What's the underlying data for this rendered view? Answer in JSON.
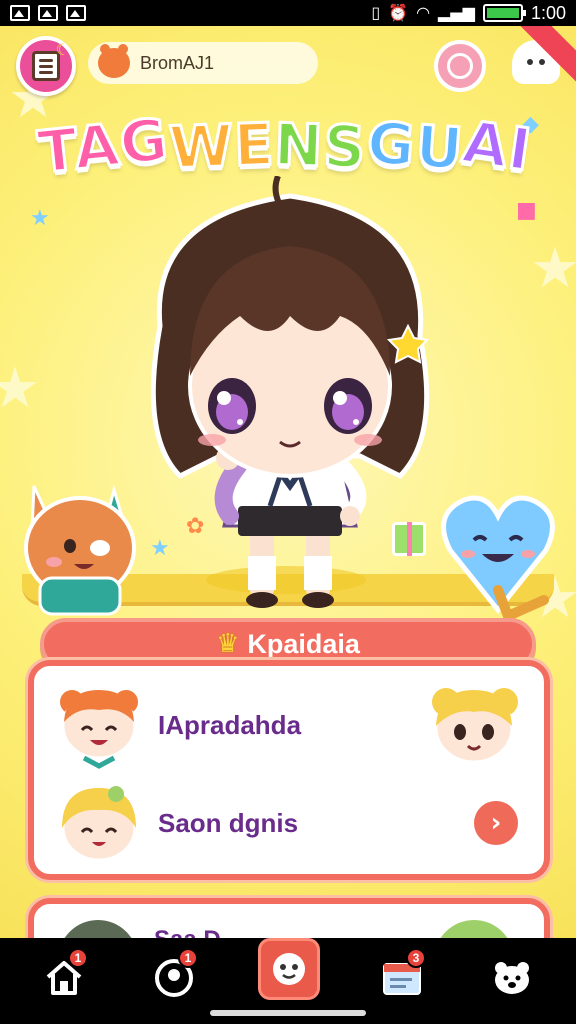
{
  "status_bar": {
    "left_icons": [
      "image-icon",
      "image-icon",
      "image-icon"
    ],
    "right_icons": [
      "vibrate-icon",
      "alarm-icon",
      "wifi-icon",
      "signal-icon",
      "battery-icon"
    ],
    "battery_level": 1.0,
    "time": "1:00"
  },
  "header": {
    "user_name": "BromAJ1",
    "title_parts": [
      "TAG",
      "WE ",
      "NS",
      "GU",
      "AI"
    ]
  },
  "panel": {
    "header_label": "Kpaidaia",
    "rows": [
      {
        "label": "IApradahda"
      },
      {
        "label": "Saon dgnis"
      }
    ],
    "next_row_peek": "Saa D..."
  },
  "bottom_nav": {
    "items": [
      {
        "icon": "home-icon",
        "badge": "1"
      },
      {
        "icon": "profile-icon",
        "badge": "1"
      },
      {
        "icon": "mascot-icon",
        "badge": ""
      },
      {
        "icon": "inbox-icon",
        "badge": "3"
      },
      {
        "icon": "bear-icon",
        "badge": ""
      }
    ]
  },
  "colors": {
    "background": "#fdf07a",
    "accent": "#f26d5f",
    "row_text": "#6a2c8c",
    "badge": "#e8433a"
  }
}
